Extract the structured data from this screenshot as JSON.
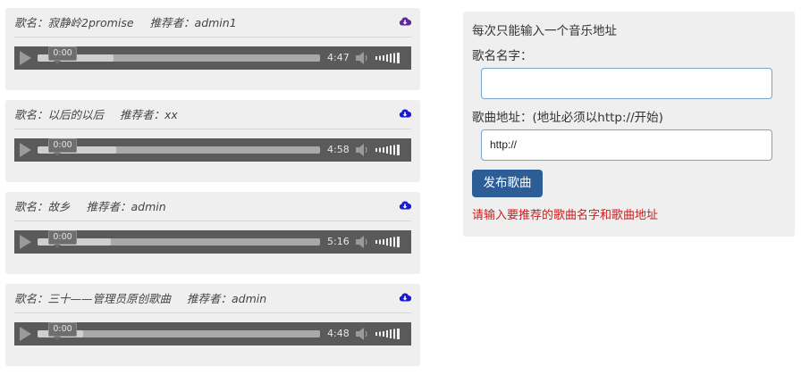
{
  "songs": [
    {
      "name_label": "歌名：寂静岭2promise",
      "recommender_label": "推荐者：admin1",
      "current_time": "0:00",
      "duration": "4:47",
      "loaded_fraction": 0.27,
      "icon_color": "#5b2aa0"
    },
    {
      "name_label": "歌名：以后的以后",
      "recommender_label": "推荐者：xx",
      "current_time": "0:00",
      "duration": "4:58",
      "loaded_fraction": 0.28,
      "icon_color": "#1a1ad6"
    },
    {
      "name_label": "歌名：故乡",
      "recommender_label": "推荐者：admin",
      "current_time": "0:00",
      "duration": "5:16",
      "loaded_fraction": 0.26,
      "icon_color": "#1a1ad6"
    },
    {
      "name_label": "歌名：三十——管理员原创歌曲",
      "recommender_label": "推荐者：admin",
      "current_time": "0:00",
      "duration": "4:48",
      "loaded_fraction": 0.16,
      "icon_color": "#1a1ad6"
    }
  ],
  "form": {
    "hint": "每次只能输入一个音乐地址",
    "name_label": "歌名名字：",
    "name_value": "",
    "url_label": "歌曲地址：(地址必须以http://开始)",
    "url_value": "http://",
    "submit_label": "发布歌曲",
    "error_text": "请输入要推荐的歌曲名字和歌曲地址",
    "button_color": "#2d5d96",
    "error_color": "#c81e1e"
  }
}
